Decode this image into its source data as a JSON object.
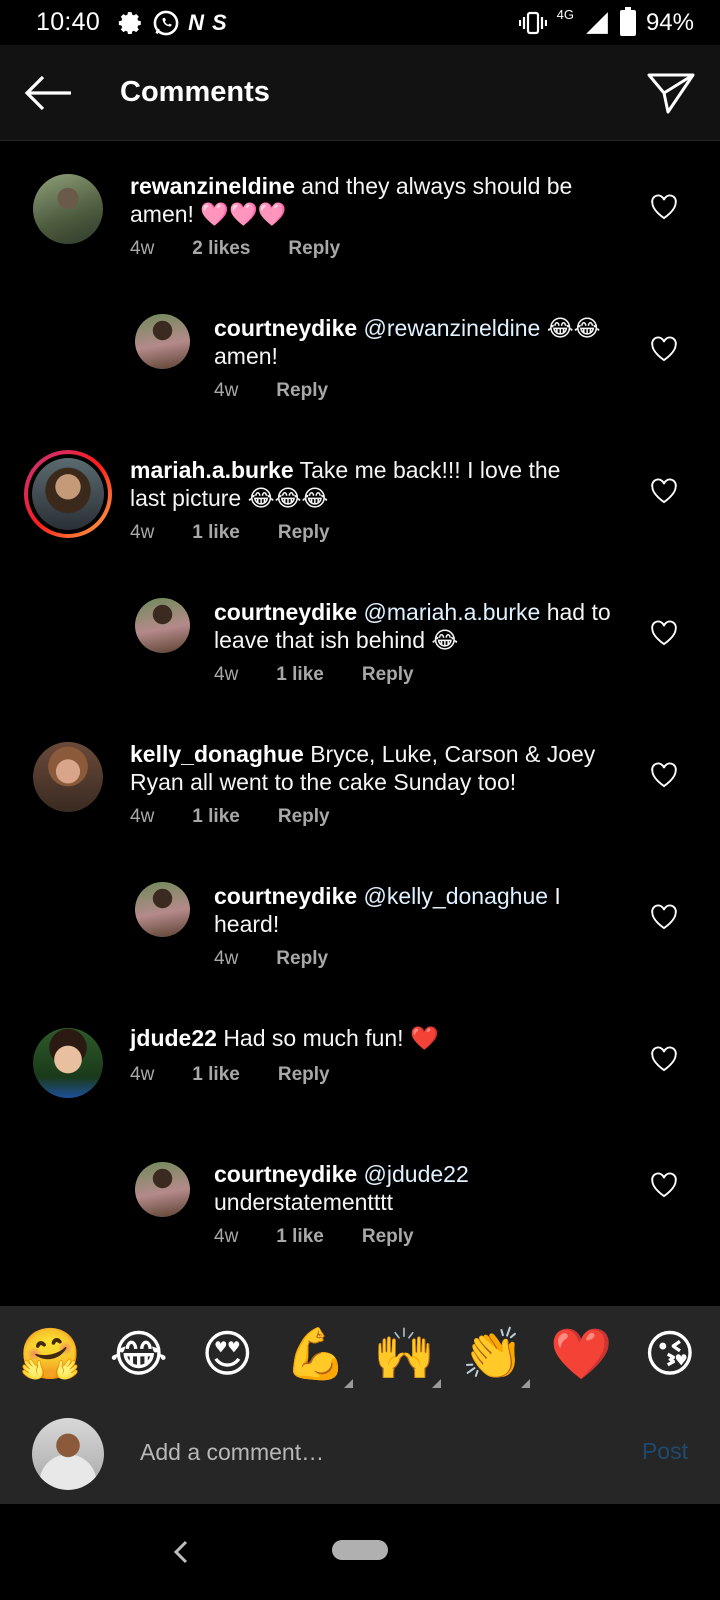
{
  "status_bar": {
    "time": "10:40",
    "network": "4G",
    "battery": "94%",
    "left_icons": [
      "gear-icon",
      "whatsapp-icon",
      "n-icon",
      "s-icon"
    ]
  },
  "header": {
    "title": "Comments"
  },
  "comments": [
    {
      "username": "rewanzineldine",
      "text": "and they always should be amen! 🩷🩷🩷",
      "time": "4w",
      "likes": "2 likes",
      "reply": "Reply",
      "is_reply": false
    },
    {
      "username": "courtneydike",
      "mention": "@rewanzineldine",
      "text": "😂😂 amen!",
      "time": "4w",
      "likes": "",
      "reply": "Reply",
      "is_reply": true
    },
    {
      "username": "mariah.a.burke",
      "text": "Take me back!!! I love the last picture 😂😂😂",
      "time": "4w",
      "likes": "1 like",
      "reply": "Reply",
      "is_reply": false
    },
    {
      "username": "courtneydike",
      "mention": "@mariah.a.burke",
      "text": "had to leave that ish behind 😂",
      "time": "4w",
      "likes": "1 like",
      "reply": "Reply",
      "is_reply": true
    },
    {
      "username": "kelly_donaghue",
      "text": "Bryce, Luke, Carson & Joey Ryan all went to the cake Sunday too!",
      "time": "4w",
      "likes": "1 like",
      "reply": "Reply",
      "is_reply": false
    },
    {
      "username": "courtneydike",
      "mention": "@kelly_donaghue",
      "text": "I heard!",
      "time": "4w",
      "likes": "",
      "reply": "Reply",
      "is_reply": true
    },
    {
      "username": "jdude22",
      "text": "Had so much fun! ❤️",
      "time": "4w",
      "likes": "1 like",
      "reply": "Reply",
      "is_reply": false
    },
    {
      "username": "courtneydike",
      "mention": "@jdude22",
      "text": "understatementttt",
      "time": "4w",
      "likes": "1 like",
      "reply": "Reply",
      "is_reply": true
    }
  ],
  "emoji_bar": [
    "🤗",
    "😂",
    "😍",
    "💪",
    "🙌",
    "👏",
    "❤️",
    "😘"
  ],
  "comment_input": {
    "placeholder": "Add a comment…",
    "post_label": "Post"
  },
  "colors": {
    "background": "#000000",
    "header": "#121212",
    "panel": "#262626",
    "meta_text": "#a8a8a8",
    "post_disabled": "#1d4a6e",
    "story_ring": [
      "#c13584",
      "#fd1d1d",
      "#fcaf45"
    ]
  }
}
